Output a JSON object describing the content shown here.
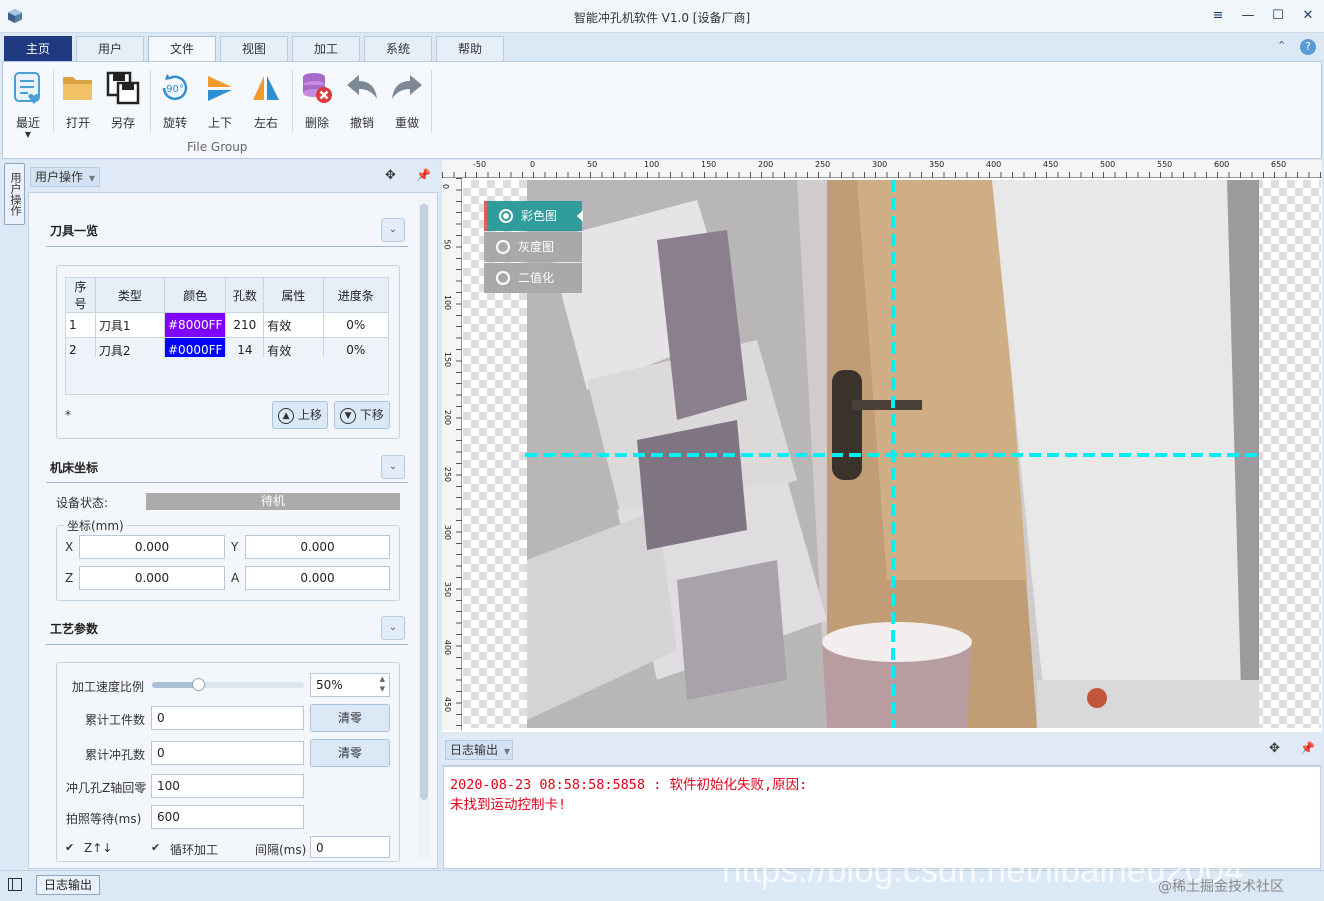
{
  "window": {
    "title": "智能冲孔机软件 V1.0 [设备厂商]",
    "controls": {
      "menu": "≡",
      "minimize": "—",
      "maximize": "☐",
      "close": "✕"
    }
  },
  "menu_tabs": [
    {
      "label": "主页",
      "state": "home"
    },
    {
      "label": "用户",
      "state": "normal"
    },
    {
      "label": "文件",
      "state": "active"
    },
    {
      "label": "视图",
      "state": "normal"
    },
    {
      "label": "加工",
      "state": "normal"
    },
    {
      "label": "系统",
      "state": "normal"
    },
    {
      "label": "帮助",
      "state": "normal"
    }
  ],
  "ribbon": {
    "group_label": "File Group",
    "buttons": {
      "recent": "最近",
      "open": "打开",
      "save_as": "另存",
      "rotate": "旋转",
      "flip_vertical": "上下",
      "flip_horizontal": "左右",
      "delete": "删除",
      "undo": "撤销",
      "redo": "重做"
    },
    "rotate_badge": "90°"
  },
  "side_tab": "用户操作",
  "left_panel": {
    "header_tab": "用户操作",
    "tools_section": {
      "title": "刀具一览",
      "columns": [
        "序号",
        "类型",
        "颜色",
        "孔数",
        "属性",
        "进度条"
      ],
      "rows": [
        {
          "index": "1",
          "type": "刀具1",
          "color": "#8000FF",
          "holes": "210",
          "attr": "有效",
          "progress": "0%"
        },
        {
          "index": "2",
          "type": "刀具2",
          "color": "#0000FF",
          "holes": "14",
          "attr": "有效",
          "progress": "0%"
        }
      ],
      "footnote": "*",
      "move_up": "上移",
      "move_down": "下移"
    },
    "machine_section": {
      "title": "机床坐标",
      "status_label": "设备状态:",
      "status_value": "待机",
      "coord_group": "坐标(mm)",
      "axes": [
        {
          "name": "X",
          "value": "0.000"
        },
        {
          "name": "Y",
          "value": "0.000"
        },
        {
          "name": "Z",
          "value": "0.000"
        },
        {
          "name": "A",
          "value": "0.000"
        }
      ]
    },
    "process_section": {
      "title": "工艺参数",
      "speed_label": "加工速度比例",
      "speed_value": "50%",
      "speed_fraction": 0.3,
      "workpiece_label": "累计工件数",
      "workpiece_value": "0",
      "punch_label": "累计冲孔数",
      "punch_value": "0",
      "clear_label": "清零",
      "z_return_label": "冲几孔Z轴回零",
      "z_return_value": "100",
      "photo_wait_label": "拍照等待(ms)",
      "photo_wait_value": "600",
      "z_check_label": "Z↑↓",
      "z_check": true,
      "loop_check_label": "循环加工",
      "loop_check": true,
      "interval_label": "间隔(ms)",
      "interval_value": "0"
    }
  },
  "canvas": {
    "h_ruler": [
      "-50",
      "0",
      "50",
      "100",
      "150",
      "200",
      "250",
      "300",
      "350",
      "400",
      "450",
      "500",
      "550",
      "600",
      "650"
    ],
    "v_ruler": [
      "0",
      "50",
      "100",
      "150",
      "200",
      "250",
      "300",
      "350",
      "400",
      "450"
    ],
    "view_modes": [
      {
        "label": "彩色图",
        "selected": true
      },
      {
        "label": "灰度图",
        "selected": false
      },
      {
        "label": "二值化",
        "selected": false
      }
    ],
    "crosshair_color": "#00FFFF"
  },
  "log_panel": {
    "header_tab": "日志输出",
    "lines": [
      "2020-08-23 08:58:58:5858 : 软件初始化失败,原因:",
      "未找到运动控制卡!"
    ]
  },
  "statusbar": {
    "log_button": "日志输出"
  },
  "watermark": {
    "url": "https://blog.csdn.net/libaineu2004",
    "credit": "@稀土掘金技术社区"
  }
}
